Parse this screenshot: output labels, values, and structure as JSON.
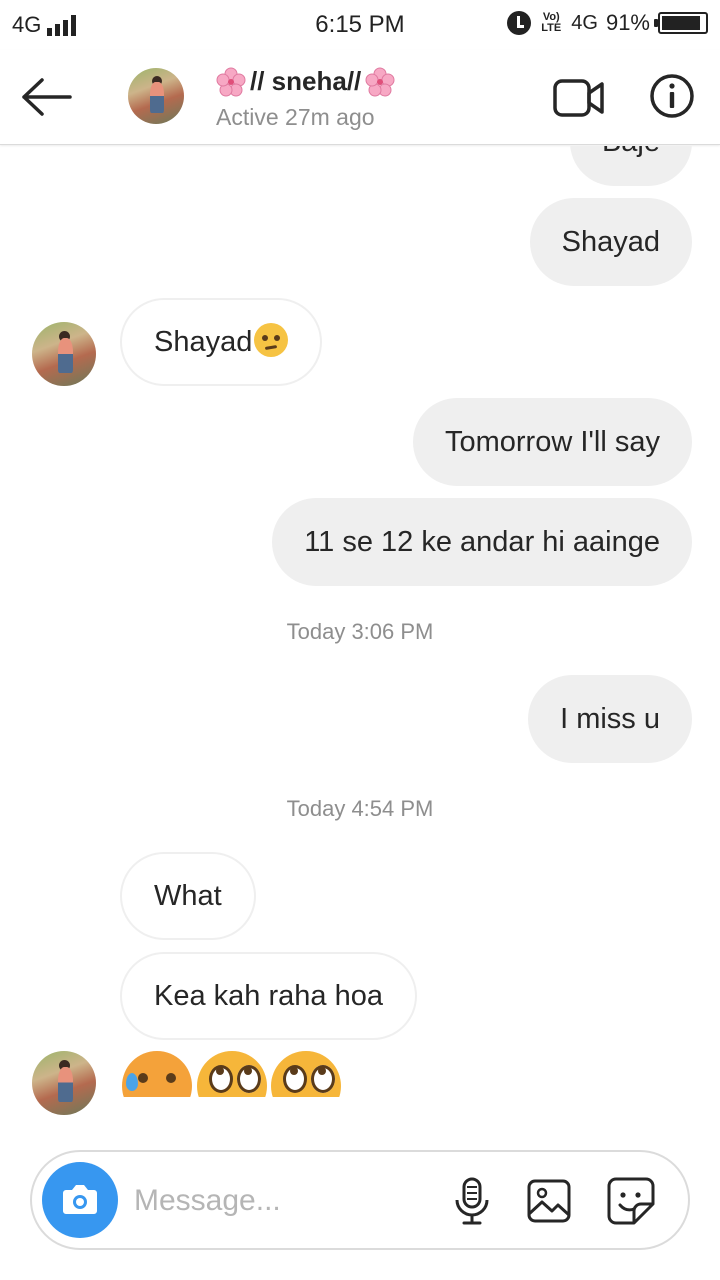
{
  "status_bar": {
    "network_left": "4G",
    "time": "6:15 PM",
    "volte": "Vo) LTE",
    "network_right": "4G",
    "battery_percent_text": "91%",
    "battery_level": 0.91
  },
  "header": {
    "name": "// sneha//",
    "status": "Active 27m ago",
    "icons": [
      "back-arrow-icon",
      "video-call-icon",
      "info-icon"
    ]
  },
  "messages": {
    "m0": {
      "text": "Baje",
      "direction": "outgoing"
    },
    "m1": {
      "text": "Shayad",
      "direction": "outgoing"
    },
    "m2": {
      "text": "Shayad",
      "direction": "incoming",
      "emoji": "raised-eyebrow"
    },
    "m3": {
      "text": "Tomorrow I'll say",
      "direction": "outgoing"
    },
    "m4": {
      "text": "11 se 12 ke andar hi aainge",
      "direction": "outgoing"
    },
    "ts1": "Today 3:06 PM",
    "m5": {
      "text": "I miss u",
      "direction": "outgoing"
    },
    "ts2": "Today 4:54 PM",
    "m6": {
      "text": "What",
      "direction": "incoming"
    },
    "m7": {
      "text": "Kea kah raha hoa",
      "direction": "incoming"
    },
    "m8": {
      "emojis": [
        "sad-sweat-face",
        "eye-roll-face",
        "eye-roll-face"
      ],
      "direction": "incoming"
    }
  },
  "composer": {
    "placeholder": "Message...",
    "icons": [
      "camera-icon",
      "microphone-icon",
      "gallery-icon",
      "sticker-icon"
    ]
  },
  "colors": {
    "accent": "#3797f0",
    "outgoing_bubble": "#efefef",
    "secondary_text": "#8e8e8e"
  }
}
